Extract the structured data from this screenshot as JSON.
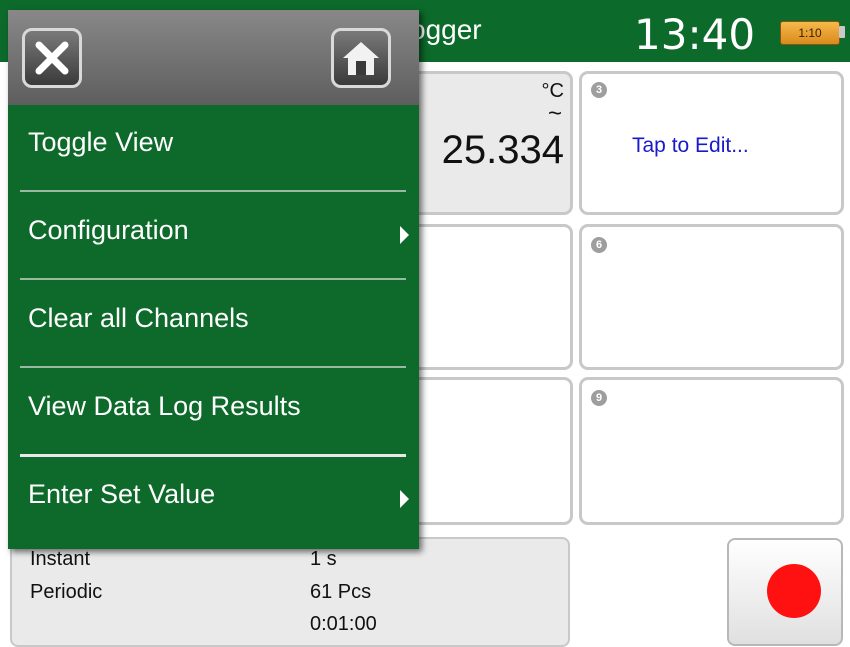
{
  "topbar": {
    "title": "ogger",
    "time": "13:40",
    "battery": "1:10"
  },
  "channels": {
    "c2": {
      "unit": "°C",
      "tilde": "~",
      "value": "25.334"
    },
    "c3": {
      "num": "3",
      "hint": "Tap to Edit..."
    },
    "c6": {
      "num": "6"
    },
    "c9": {
      "num": "9"
    }
  },
  "bottom": {
    "row1_label": "Instant",
    "row1_value": "1 s",
    "row2_label": "Periodic",
    "row2_value": "61 Pcs",
    "row3_value": "0:01:00"
  },
  "menu": {
    "items": [
      {
        "label": "Toggle View",
        "submenu": false
      },
      {
        "label": "Configuration",
        "submenu": true
      },
      {
        "label": "Clear all Channels",
        "submenu": false
      },
      {
        "label": "View Data Log Results",
        "submenu": false
      },
      {
        "label": "Enter Set Value",
        "submenu": true
      }
    ]
  },
  "icons": {
    "close": "close-icon",
    "home": "home-icon",
    "record": "record-icon"
  },
  "colors": {
    "brand_green": "#0c6a2b",
    "record_red": "#ff1111",
    "link_blue": "#1a1acc"
  }
}
